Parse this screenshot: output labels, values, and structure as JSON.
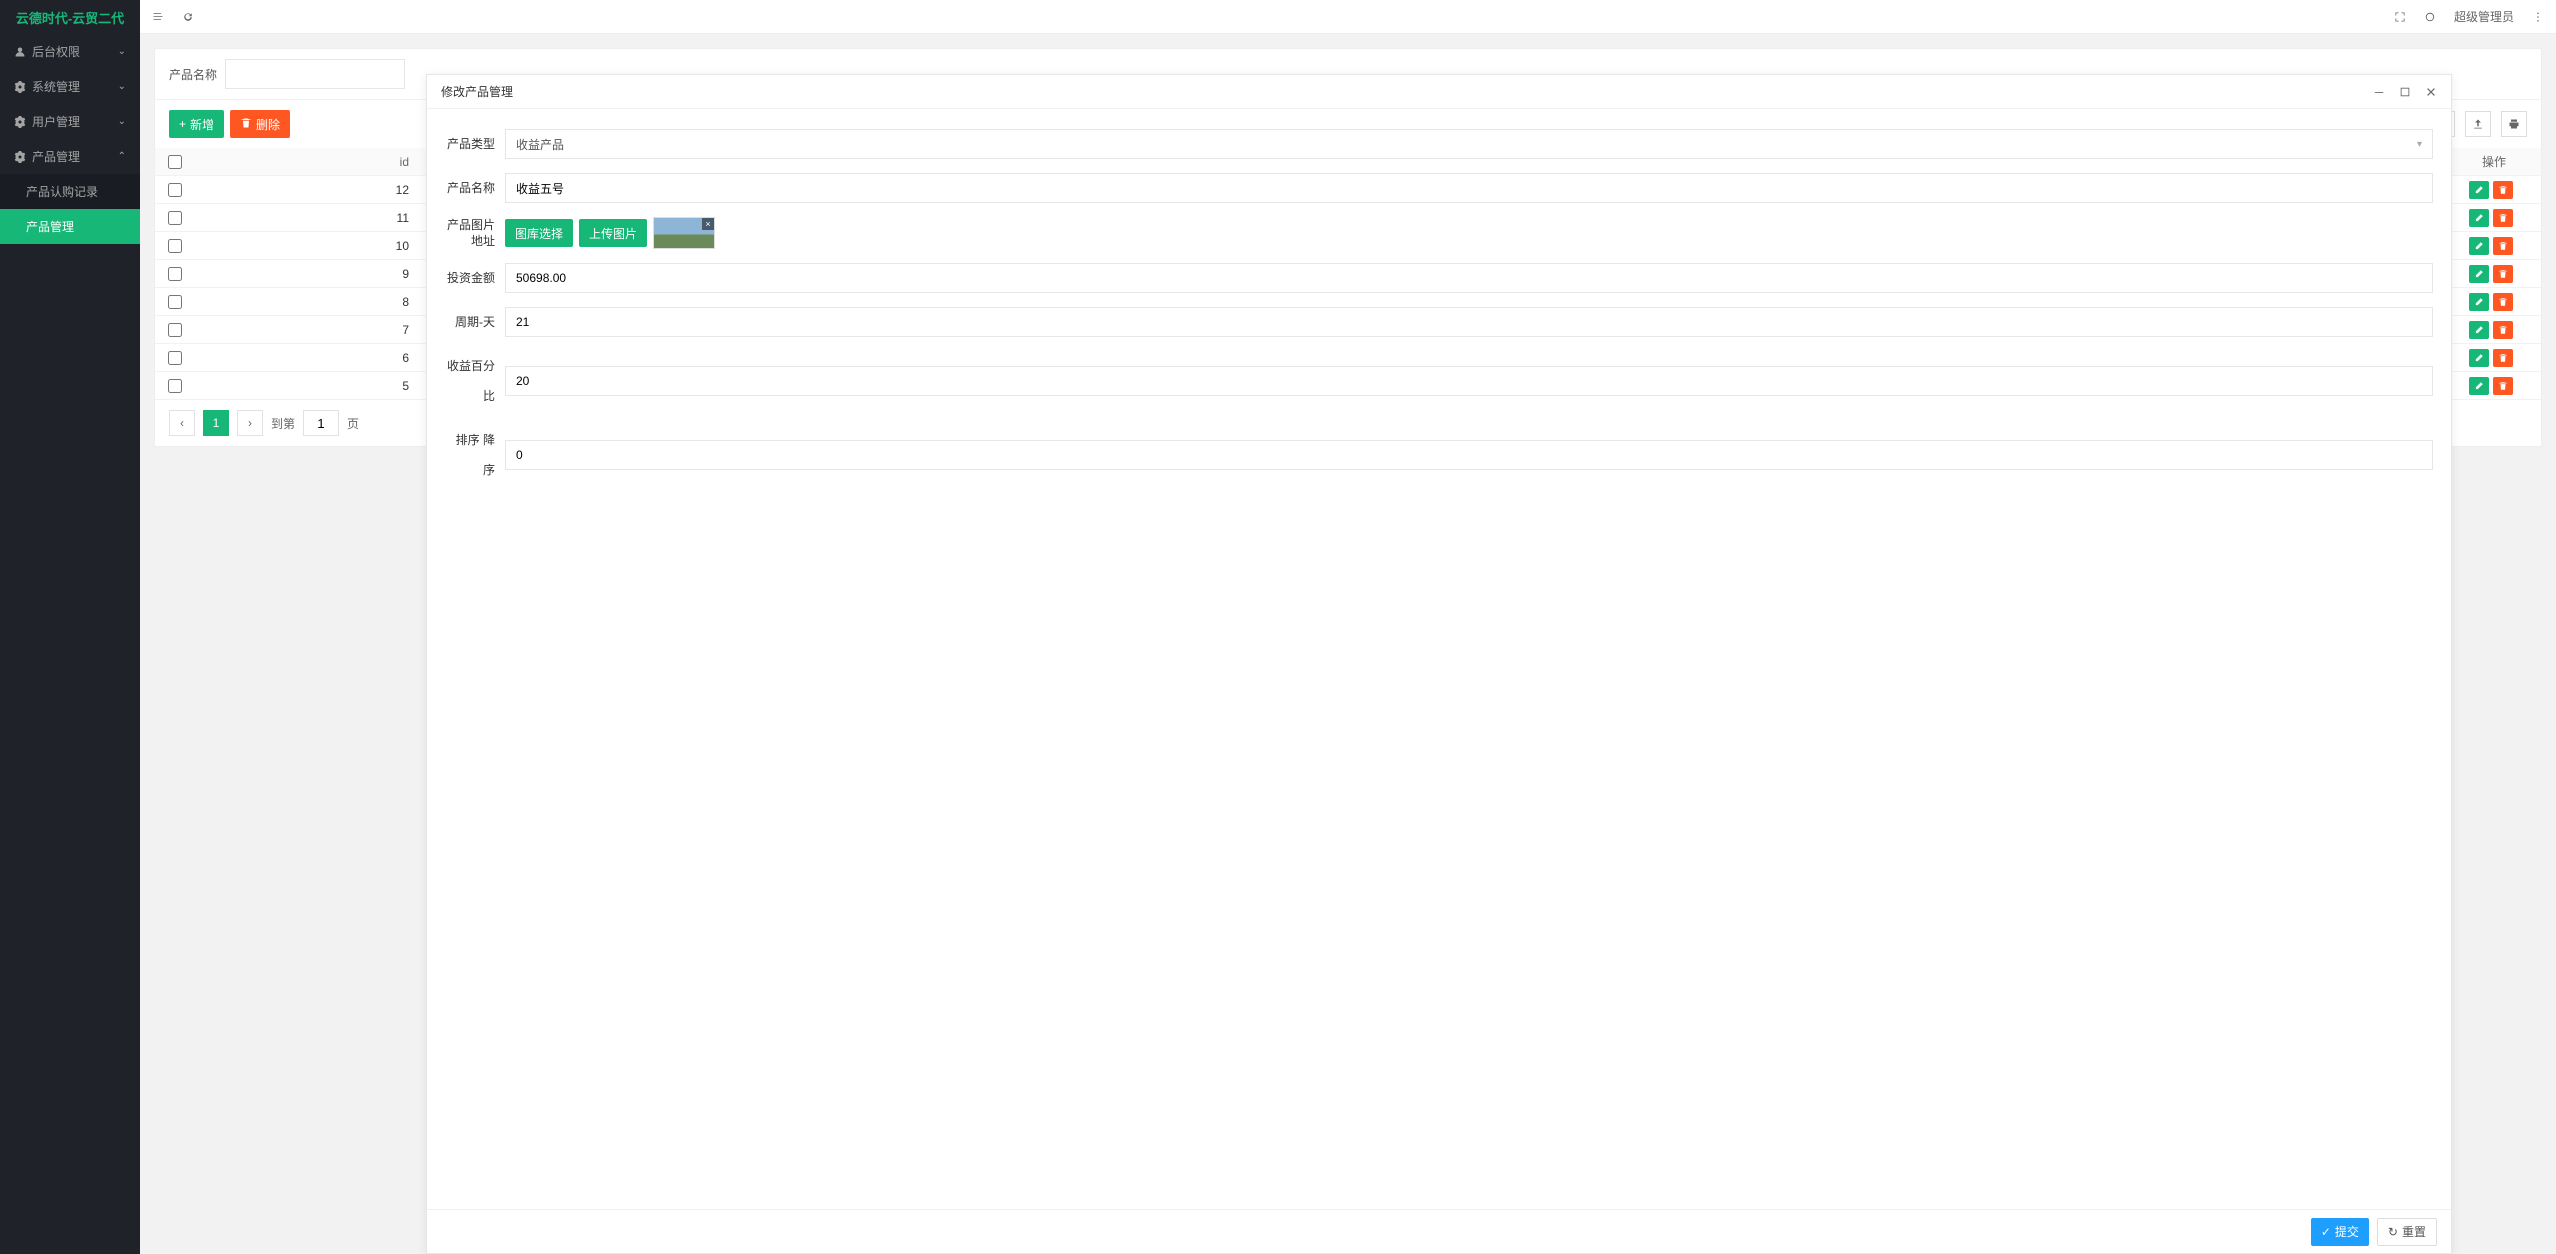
{
  "brand": "云德时代-云贸二代",
  "user_label": "超级管理员",
  "sidebar": {
    "items": [
      {
        "label": "后台权限",
        "icon": "user-icon"
      },
      {
        "label": "系统管理",
        "icon": "gear-icon"
      },
      {
        "label": "用户管理",
        "icon": "gear-icon"
      },
      {
        "label": "产品管理",
        "icon": "gear-icon"
      }
    ],
    "sub": [
      {
        "label": "产品认购记录"
      },
      {
        "label": "产品管理"
      }
    ]
  },
  "search": {
    "label": "产品名称",
    "value": ""
  },
  "toolbar": {
    "add": "新增",
    "del": "删除"
  },
  "table": {
    "head_id": "id",
    "head_ops": "操作",
    "rows": [
      {
        "id": "12"
      },
      {
        "id": "11"
      },
      {
        "id": "10"
      },
      {
        "id": "9"
      },
      {
        "id": "8"
      },
      {
        "id": "7"
      },
      {
        "id": "6"
      },
      {
        "id": "5"
      }
    ]
  },
  "pager": {
    "current": "1",
    "goto_label": "到第",
    "goto_value": "1",
    "page_suffix": "页"
  },
  "modal": {
    "title": "修改产品管理",
    "fields": {
      "type_label": "产品类型",
      "type_value": "收益产品",
      "name_label": "产品名称",
      "name_value": "收益五号",
      "img_label": "产品图片地址",
      "btn_gallery": "图库选择",
      "btn_upload": "上传图片",
      "amount_label": "投资金额",
      "amount_value": "50698.00",
      "cycle_label": "周期-天",
      "cycle_value": "21",
      "pct_label": "收益百分比",
      "pct_value": "20",
      "sort_label": "排序 降序",
      "sort_value": "0"
    },
    "submit": "提交",
    "reset": "重置"
  }
}
